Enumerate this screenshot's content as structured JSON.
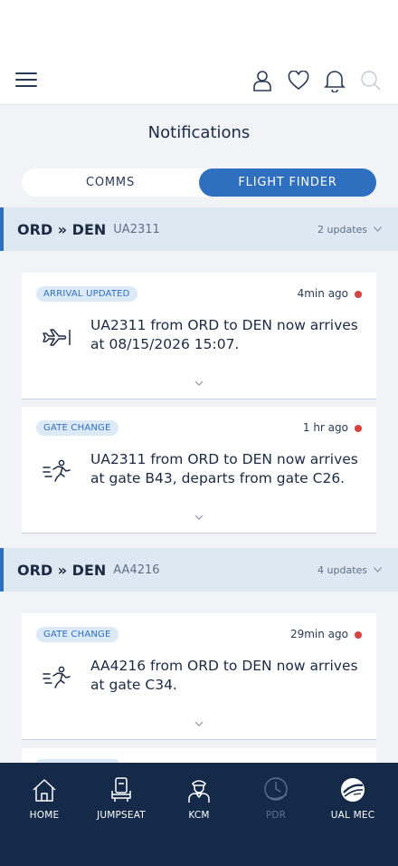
{
  "header": {
    "icons": [
      "menu-icon",
      "user-icon",
      "heart-icon",
      "bell-icon",
      "search-icon"
    ]
  },
  "page": {
    "title": "Notifications"
  },
  "tabs": [
    {
      "label": "COMMS",
      "active": false
    },
    {
      "label": "FLIGHT FINDER",
      "active": true
    }
  ],
  "groups": [
    {
      "route": "ORD » DEN",
      "flight": "UA2311",
      "updates": "2 updates",
      "notifications": [
        {
          "badge": "ARRIVAL UPDATED",
          "time": "4min ago",
          "icon": "plane-arrival-icon",
          "message": "UA2311 from ORD to DEN now arrives at 08/15/2026 15:07."
        },
        {
          "badge": "GATE CHANGE",
          "time": "1 hr ago",
          "icon": "person-walking-icon",
          "message": "UA2311 from ORD to DEN now arrives at gate B43, departs from gate C26."
        }
      ]
    },
    {
      "route": "ORD » DEN",
      "flight": "AA4216",
      "updates": "4 updates",
      "notifications": [
        {
          "badge": "GATE CHANGE",
          "time": "29min ago",
          "icon": "person-walking-icon",
          "message": "AA4216 from ORD to DEN now arrives at gate C34."
        }
      ]
    }
  ],
  "bottom_nav": [
    {
      "label": "HOME",
      "icon": "home-icon",
      "enabled": true
    },
    {
      "label": "JUMPSEAT",
      "icon": "seat-icon",
      "enabled": true
    },
    {
      "label": "KCM",
      "icon": "crew-member-icon",
      "enabled": true
    },
    {
      "label": "PDR",
      "icon": "clock-globe-icon",
      "enabled": false
    },
    {
      "label": "UAL MEC",
      "icon": "ual-globe-icon",
      "enabled": true
    }
  ],
  "colors": {
    "accent": "#2f6fc0",
    "nav_background": "#152a48",
    "unread_dot": "#d9423f",
    "group_header": "#dde8f3",
    "badge_background": "#dce9f7"
  }
}
